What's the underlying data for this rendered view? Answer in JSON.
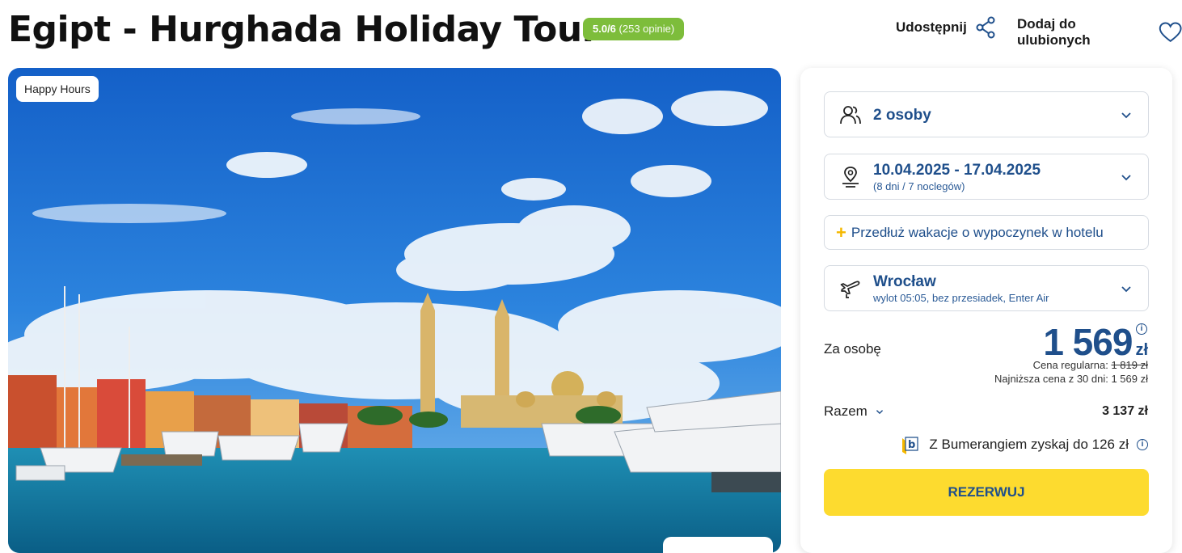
{
  "header": {
    "title": "Egipt - Hurghada Holiday Tour",
    "rating_score": "5.0/6",
    "rating_count": "(253 opinie)",
    "share_label": "Udostępnij",
    "favorite_label": "Dodaj do ulubionych"
  },
  "hero": {
    "badge": "Happy Hours"
  },
  "booking": {
    "travelers": "2 osoby",
    "dates": "10.04.2025 - 17.04.2025",
    "duration": "(8 dni / 7 noclegów)",
    "extend_label": "Przedłuż wakacje o wypoczynek w hotelu",
    "departure_city": "Wrocław",
    "flight_info": "wylot 05:05, bez przesiadek, Enter Air",
    "per_person_label": "Za osobę",
    "price": "1 569",
    "currency": "zł",
    "regular_price_label": "Cena regularna:",
    "regular_price": "1 819 zł",
    "lowest_price_text": "Najniższa cena z 30 dni: 1 569 zł",
    "total_label": "Razem",
    "total_value": "3 137 zł",
    "bumerang_text": "Z Bumerangiem zyskaj do 126 zł",
    "book_button": "REZERWUJ"
  },
  "colors": {
    "accent_blue": "#1f4f8b",
    "rating_green": "#7dbd3b",
    "book_yellow": "#fddb2f"
  },
  "icons": [
    "share-icon",
    "heart-icon",
    "people-icon",
    "location-calendar-icon",
    "plane-icon",
    "chevron-down-icon",
    "info-icon",
    "bumerang-logo"
  ]
}
